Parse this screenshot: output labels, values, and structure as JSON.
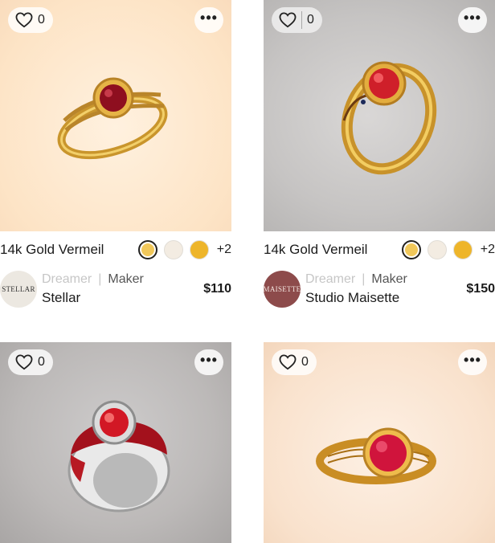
{
  "products": [
    {
      "like_count": "0",
      "title": "14k Gold Vermeil",
      "swatches": [
        "#f1c85a",
        "#f3ece2",
        "#eeb52a"
      ],
      "more_colors": "+2",
      "avatar_text": "STELLAR",
      "role_a": "Dreamer",
      "role_sep": "|",
      "role_b": "Maker",
      "maker_name": "Stellar",
      "price": "$110"
    },
    {
      "like_count": "0",
      "title": "14k Gold Vermeil",
      "swatches": [
        "#f1c85a",
        "#f3ece2",
        "#eeb52a"
      ],
      "more_colors": "+2",
      "avatar_text": "MAISETTE",
      "role_a": "Dreamer",
      "role_sep": "|",
      "role_b": "Maker",
      "maker_name": "Studio Maisette",
      "price": "$150"
    },
    {
      "like_count": "0"
    },
    {
      "like_count": "0"
    }
  ],
  "icons": {
    "like": "heart-icon",
    "more": "ellipsis-icon"
  }
}
